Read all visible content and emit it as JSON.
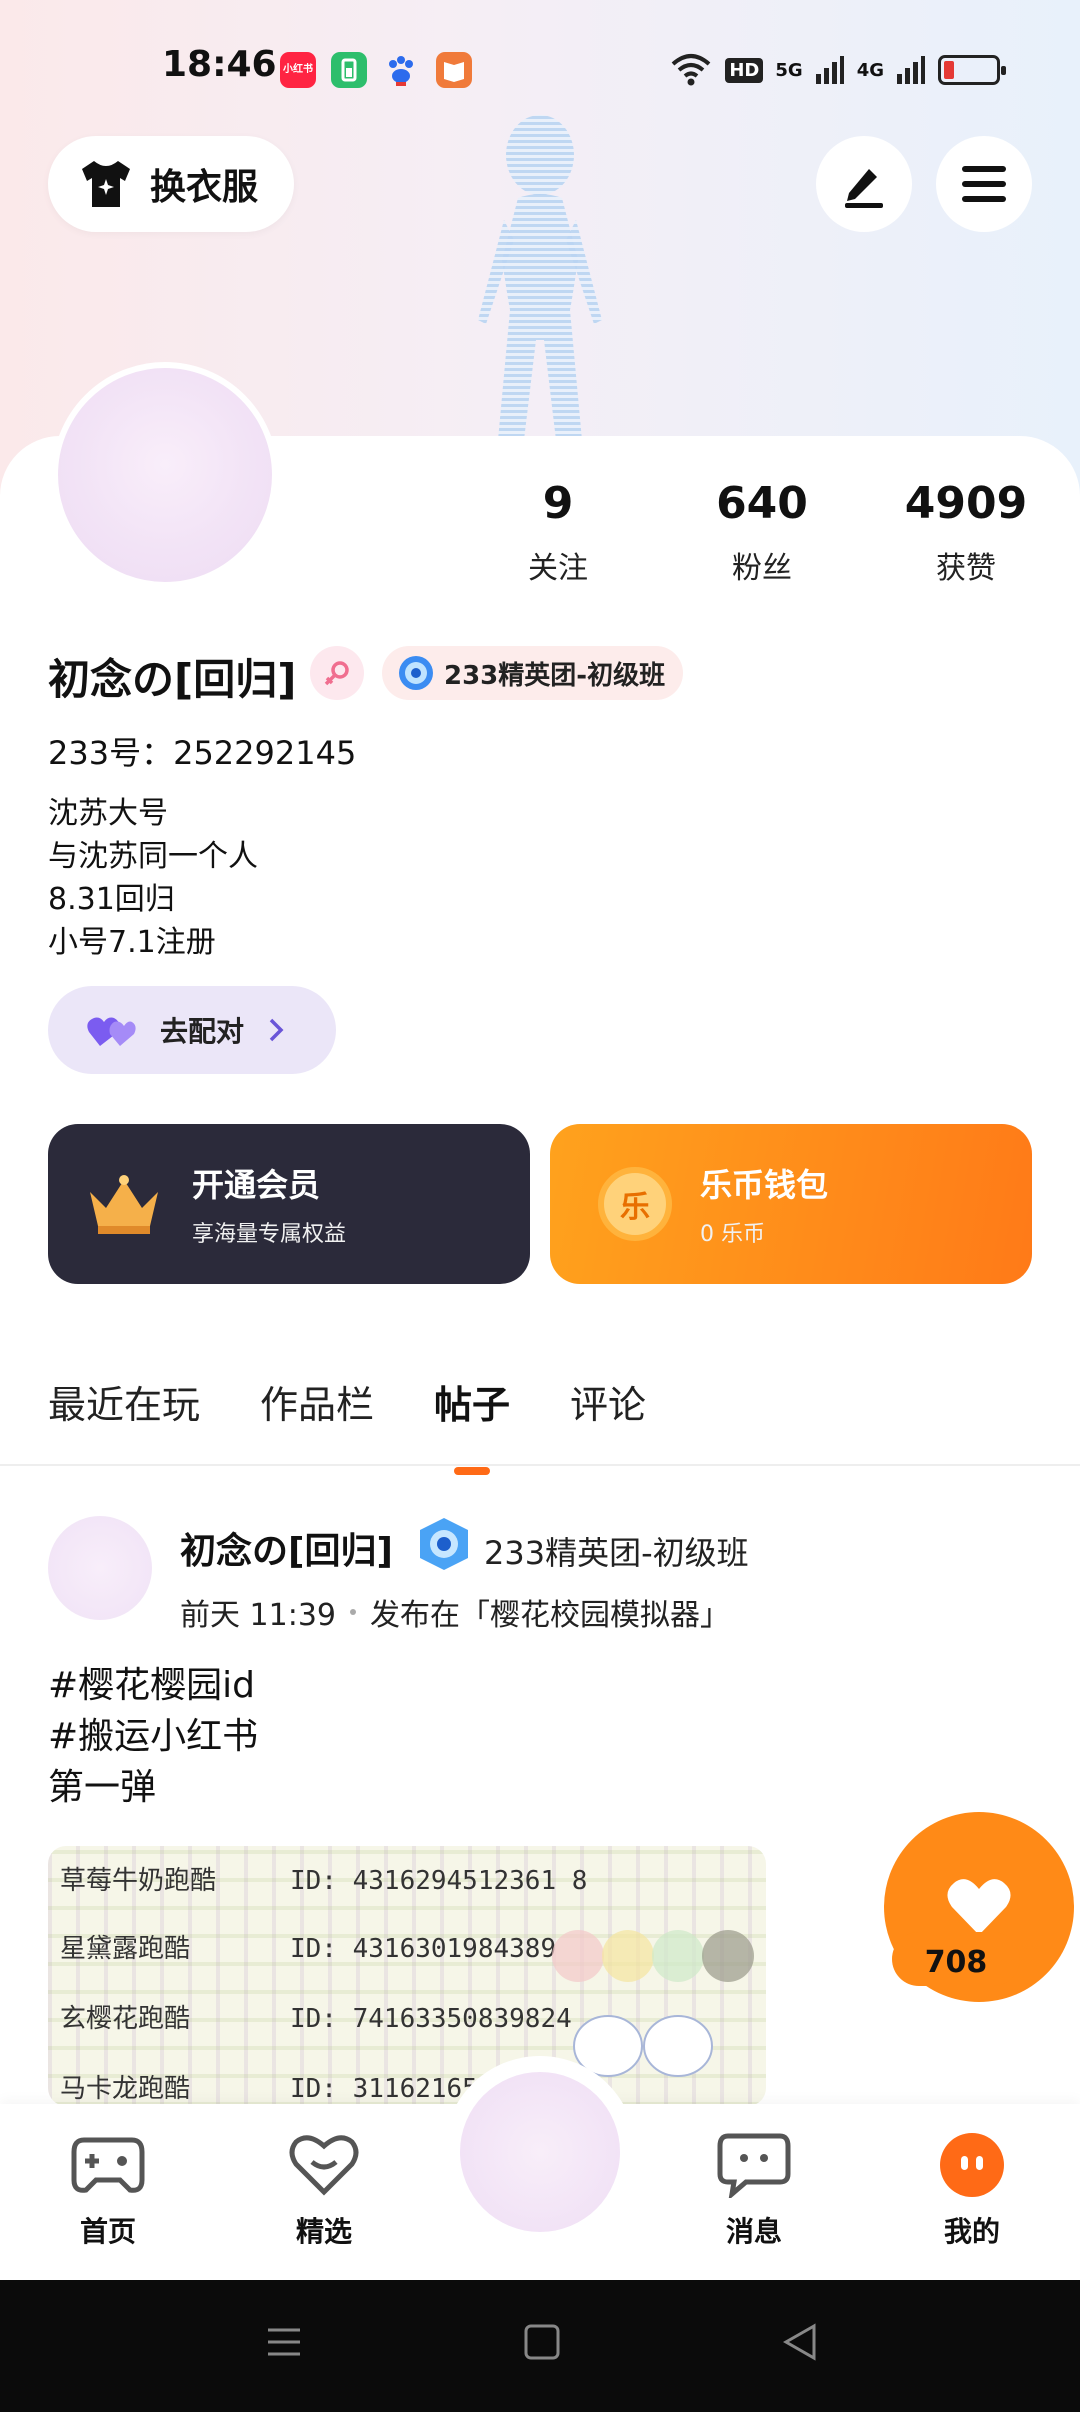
{
  "status_bar": {
    "time": "18:46",
    "notification_icons": [
      "xiaohongshu-icon",
      "battery-app-icon",
      "baidu-icon",
      "reader-icon"
    ],
    "xiaohongshu_label": "小红书",
    "network": [
      "5G",
      "4G"
    ],
    "hd_label": "HD"
  },
  "header": {
    "change_clothes_label": "换衣服"
  },
  "stats": [
    {
      "value": "9",
      "label": "关注"
    },
    {
      "value": "640",
      "label": "粉丝"
    },
    {
      "value": "4909",
      "label": "获赞"
    }
  ],
  "profile": {
    "nickname": "初念の[回归]",
    "rank_badge": "233精英团-初级班",
    "id_line": "233号：252292145",
    "bio": [
      "沈苏大号",
      "与沈苏同一个人",
      "8.31回归",
      "小号7.1注册"
    ],
    "match_label": "去配对"
  },
  "promo_cards": {
    "vip_title": "开通会员",
    "vip_sub": "享海量专属权益",
    "wallet_title": "乐币钱包",
    "wallet_sub": "0 乐币",
    "coin_char": "乐"
  },
  "tabs": [
    "最近在玩",
    "作品栏",
    "帖子",
    "评论"
  ],
  "active_tab": "帖子",
  "post": {
    "author": "初念の[回归]",
    "rank": "233精英团-初级班",
    "time": "前天 11:39",
    "location": "发布在「樱花校园模拟器」",
    "text": [
      "#樱花樱园id",
      "#搬运小红书",
      "第一弹"
    ],
    "image_rows": [
      {
        "name": "草莓牛奶跑酷",
        "id": "ID: 4316294512361 8"
      },
      {
        "name": "星黛露跑酷",
        "id": "ID: 4316301984389"
      },
      {
        "name": "玄樱花跑酷",
        "id": "ID: 74163350839824"
      },
      {
        "name": "马卡龙跑酷",
        "id": "ID: 311621653"
      }
    ],
    "like_count": "708"
  },
  "bottom_nav": {
    "home": "首页",
    "pick": "精选",
    "messages": "消息",
    "me": "我的"
  },
  "colors": {
    "accent_orange": "#ff7a18",
    "vip_dark": "#2b2a3a",
    "match_purple": "#7b5cf0"
  }
}
